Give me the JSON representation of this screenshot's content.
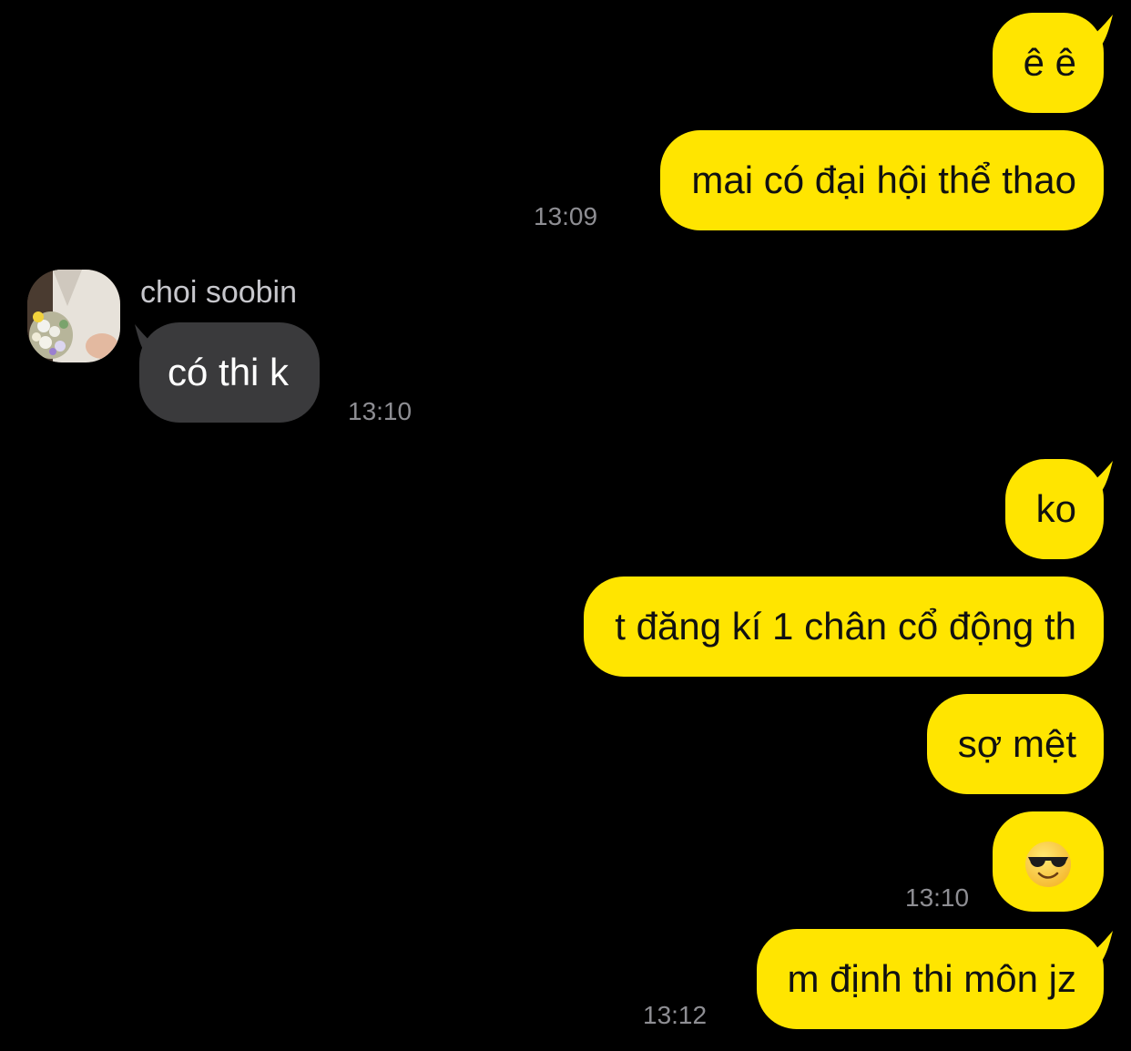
{
  "colors": {
    "background": "#000000",
    "outgoing_bubble": "#FFE500",
    "incoming_bubble": "#3A3A3C",
    "timestamp": "#8E8E93"
  },
  "contact": {
    "name": "choi soobin",
    "avatar_icon": "avatar-photo-icon"
  },
  "messages": [
    {
      "direction": "out",
      "text": "ê ê"
    },
    {
      "direction": "out",
      "text": "mai có đại hội thể thao",
      "time": "13:09"
    },
    {
      "direction": "in",
      "text": "có thi k",
      "time": "13:10"
    },
    {
      "direction": "out",
      "text": "ko"
    },
    {
      "direction": "out",
      "text": "t đăng kí 1 chân cổ động th"
    },
    {
      "direction": "out",
      "text": "sợ mệt"
    },
    {
      "direction": "out",
      "emoji": "smiling-face-with-sunglasses",
      "time": "13:10"
    },
    {
      "direction": "out",
      "text": "m định thi môn jz",
      "time": "13:12"
    }
  ]
}
